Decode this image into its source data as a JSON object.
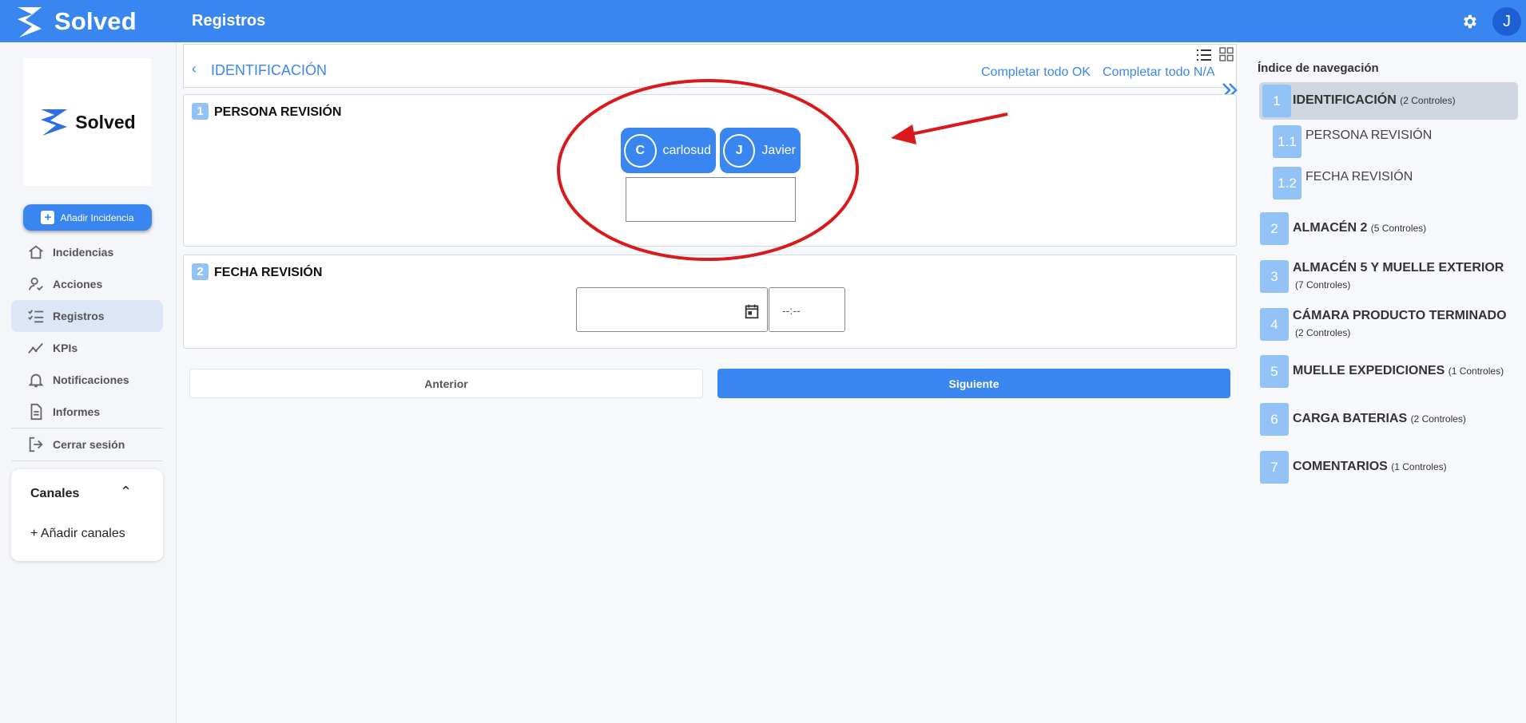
{
  "app": {
    "brand": "Solved",
    "page_title": "Registros",
    "user_initial": "J"
  },
  "sidebar": {
    "logo_text": "Solved",
    "add_incidence_label": "Añadir Incidencia",
    "items": [
      {
        "label": "Incidencias",
        "icon": "home-icon"
      },
      {
        "label": "Acciones",
        "icon": "user-check-icon"
      },
      {
        "label": "Registros",
        "icon": "checklist-icon",
        "active": true
      },
      {
        "label": "KPIs",
        "icon": "trend-icon"
      },
      {
        "label": "Notificaciones",
        "icon": "bell-icon"
      },
      {
        "label": "Informes",
        "icon": "document-icon"
      },
      {
        "label": "Cerrar sesión",
        "icon": "logout-icon"
      }
    ],
    "channels": {
      "title": "Canales",
      "add_label": "+ Añadir canales"
    }
  },
  "main": {
    "section_title": "IDENTIFICACIÓN",
    "complete_ok": "Completar todo OK",
    "complete_na": "Completar todo N/A",
    "questions": [
      {
        "number": "1",
        "title": "PERSONA REVISIÓN",
        "users": [
          {
            "initial": "C",
            "name": "carlosud"
          },
          {
            "initial": "J",
            "name": "Javier"
          }
        ],
        "text_value": ""
      },
      {
        "number": "2",
        "title": "FECHA REVISIÓN",
        "date_value": "",
        "time_placeholder": "--:--"
      }
    ],
    "prev_label": "Anterior",
    "next_label": "Siguiente"
  },
  "index": {
    "title": "Índice de navegación",
    "sections": [
      {
        "number": "1",
        "label": "IDENTIFICACIÓN",
        "count": "(2 Controles)",
        "active": true
      },
      {
        "number": "1.1",
        "label": "PERSONA REVISIÓN",
        "sub": true
      },
      {
        "number": "1.2",
        "label": "FECHA REVISIÓN",
        "sub": true
      },
      {
        "number": "2",
        "label": "ALMACÉN 2",
        "count": "(5 Controles)"
      },
      {
        "number": "3",
        "label": "ALMACÉN 5 Y MUELLE EXTERIOR",
        "count": "(7 Controles)"
      },
      {
        "number": "4",
        "label": "CÁMARA PRODUCTO TERMINADO",
        "count": "(2 Controles)"
      },
      {
        "number": "5",
        "label": "MUELLE EXPEDICIONES",
        "count": "(1 Controles)"
      },
      {
        "number": "6",
        "label": "CARGA BATERIAS",
        "count": "(2 Controles)"
      },
      {
        "number": "7",
        "label": "COMENTARIOS",
        "count": "(1 Controles)"
      }
    ]
  },
  "colors": {
    "primary": "#3a86f0",
    "badge": "#93c2f7",
    "annotation": "#d9191c",
    "active_nav": "#dce6f6"
  }
}
